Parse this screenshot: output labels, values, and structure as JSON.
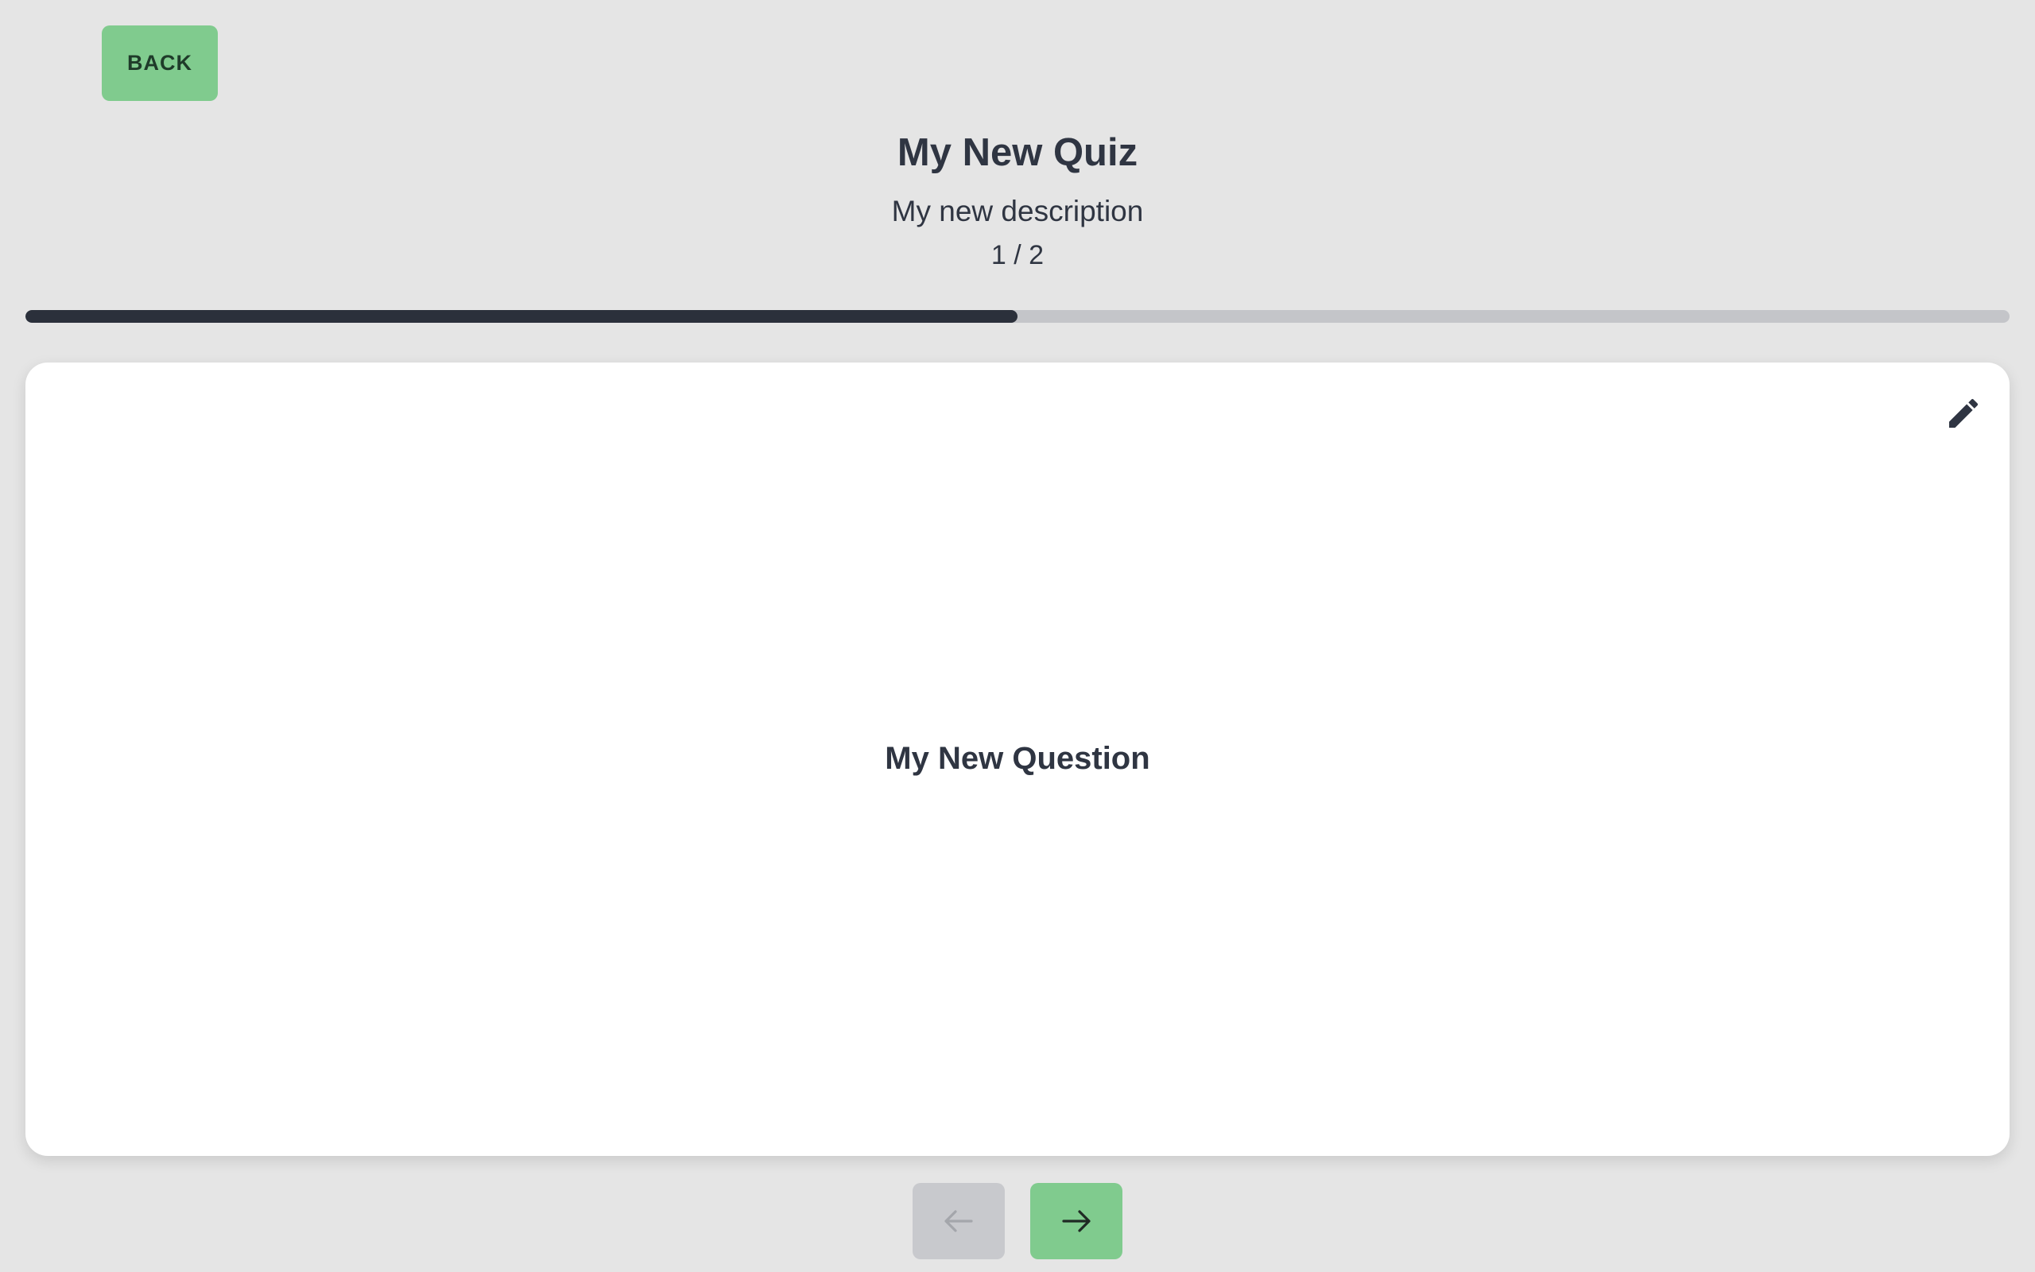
{
  "header": {
    "back_label": "BACK",
    "title": "My New Quiz",
    "description": "My new description",
    "counter": "1 / 2"
  },
  "progress": {
    "current": 1,
    "total": 2,
    "fraction": 0.5
  },
  "card": {
    "question": "My New Question",
    "edit_icon": "pencil-icon"
  },
  "nav": {
    "prev_icon": "arrow-left-icon",
    "next_icon": "arrow-right-icon",
    "prev_disabled": true
  },
  "colors": {
    "background": "#e5e5e5",
    "accent_green": "#80cb8e",
    "disabled_gray": "#c8c9cd",
    "text_dark": "#2f3542",
    "progress_fill": "#2b303b",
    "progress_track": "#c4c5c9",
    "card_bg": "#ffffff"
  }
}
